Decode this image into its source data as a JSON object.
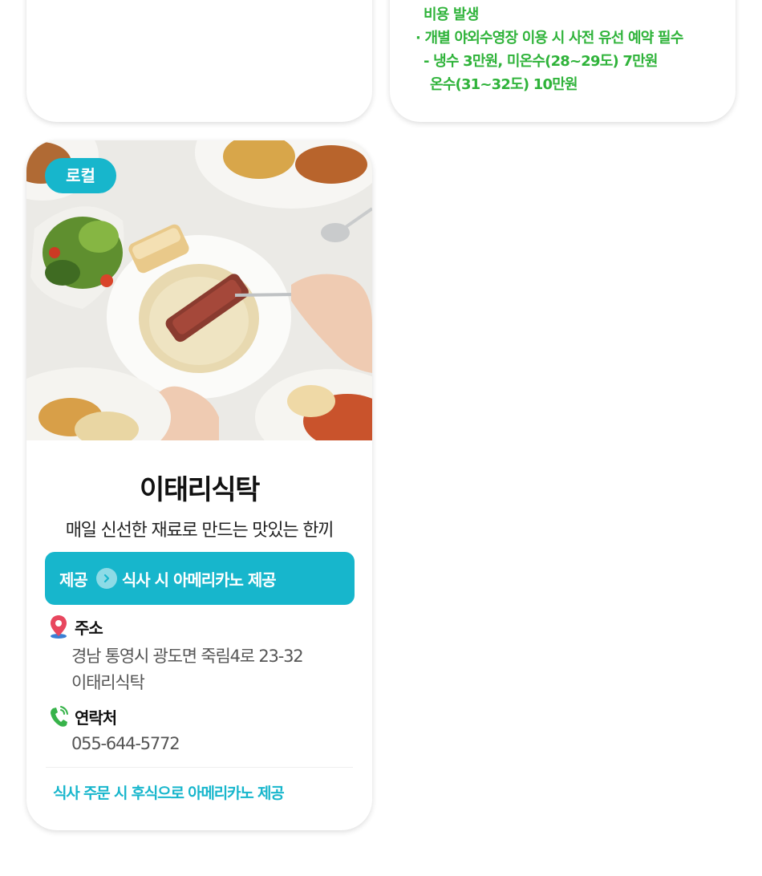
{
  "top_right_card": {
    "lines": [
      "비용 발생",
      "· 개별 야외수영장 이용 시 사전 유선 예약 필수",
      " - 냉수 3만원, 미온수(28~29도) 7만원",
      "온수(31~32도) 10만원"
    ]
  },
  "restaurant_card": {
    "badge": "로컬",
    "title": "이태리식탁",
    "subtitle": "매일 신선한 재료로 만드는 맛있는 한끼",
    "offer": {
      "label": "제공",
      "text": "식사 시 아메리카노 제공"
    },
    "address": {
      "heading": "주소",
      "line1": "경남 통영시 광도면 죽림4로 23-32",
      "line2": "이태리식탁"
    },
    "contact": {
      "heading": "연락처",
      "phone": "055-644-5772"
    },
    "note": "식사 주문 시 후식으로 아메리카노 제공"
  },
  "colors": {
    "accent": "#17b6cc",
    "notes_green": "#2fb33a",
    "pin_red": "#e8475f",
    "phone_green": "#37b34a"
  },
  "icons": [
    "chevron-right-icon",
    "map-pin-icon",
    "phone-icon"
  ]
}
